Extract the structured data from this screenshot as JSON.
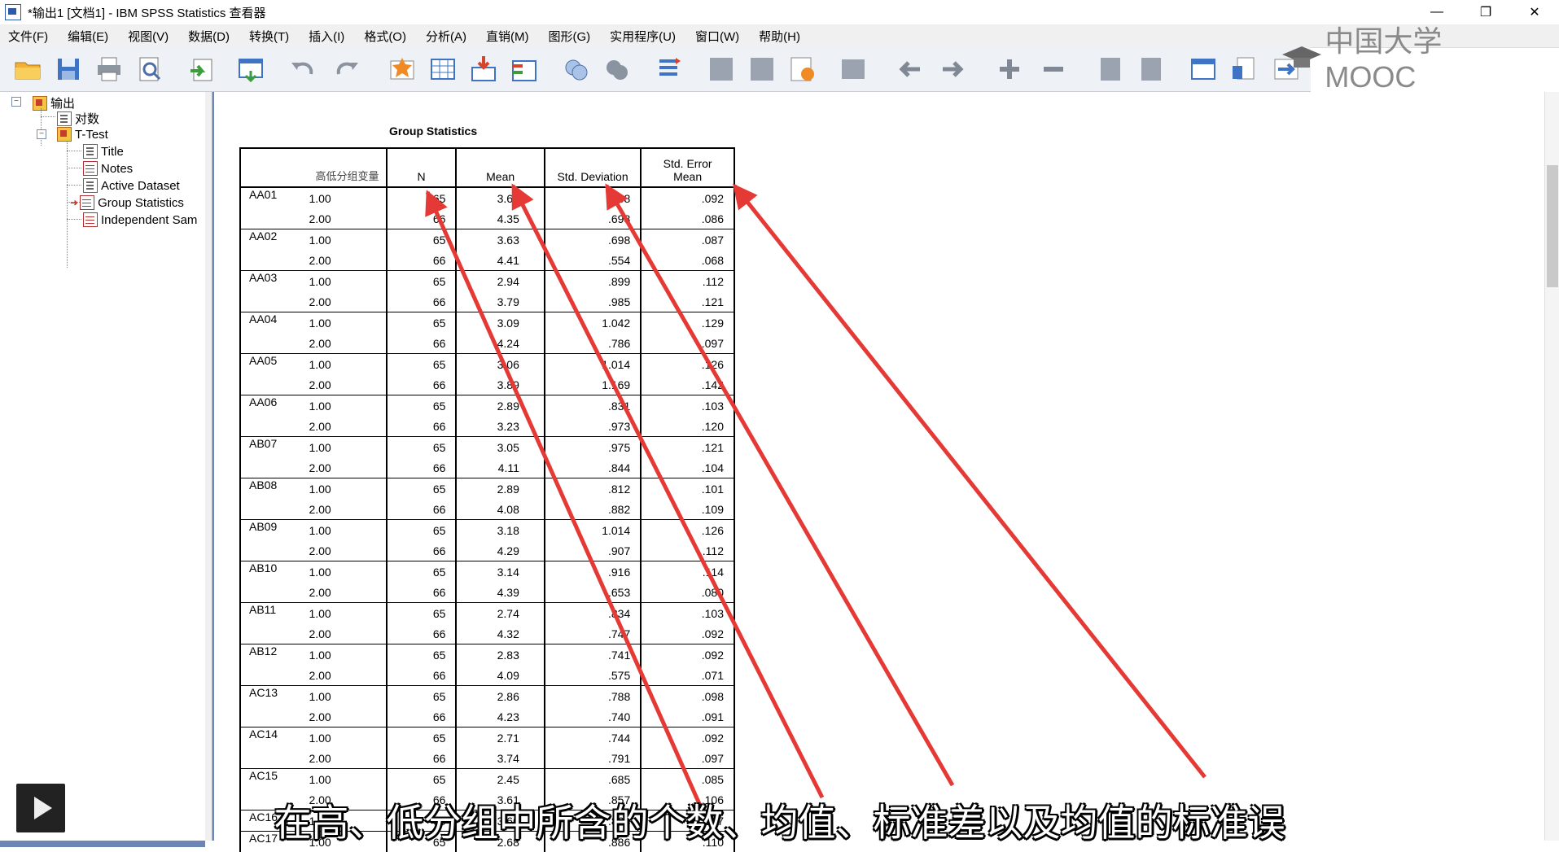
{
  "window": {
    "title": "*输出1 [文档1] - IBM SPSS Statistics 查看器",
    "minimize": "—",
    "restore": "❐",
    "close": "✕"
  },
  "menu": [
    "文件(F)",
    "编辑(E)",
    "视图(V)",
    "数据(D)",
    "转换(T)",
    "插入(I)",
    "格式(O)",
    "分析(A)",
    "直销(M)",
    "图形(G)",
    "实用程序(U)",
    "窗口(W)",
    "帮助(H)"
  ],
  "watermark": "中国大学MOOC",
  "outline": {
    "root": "输出",
    "log": "对数",
    "ttest": "T-Test",
    "children": [
      "Title",
      "Notes",
      "Active Dataset",
      "Group Statistics",
      "Independent Sam"
    ]
  },
  "table": {
    "title": "Group Statistics",
    "headers": {
      "group_var": "高低分组变量",
      "n": "N",
      "mean": "Mean",
      "sd": "Std. Deviation",
      "se_line1": "Std. Error",
      "se_line2": "Mean"
    },
    "rows": [
      {
        "var": "AA01",
        "groups": [
          [
            "1.00",
            "65",
            "3.65",
            ".738",
            ".092"
          ],
          [
            "2.00",
            "66",
            "4.35",
            ".698",
            ".086"
          ]
        ]
      },
      {
        "var": "AA02",
        "groups": [
          [
            "1.00",
            "65",
            "3.63",
            ".698",
            ".087"
          ],
          [
            "2.00",
            "66",
            "4.41",
            ".554",
            ".068"
          ]
        ]
      },
      {
        "var": "AA03",
        "groups": [
          [
            "1.00",
            "65",
            "2.94",
            ".899",
            ".112"
          ],
          [
            "2.00",
            "66",
            "3.79",
            ".985",
            ".121"
          ]
        ]
      },
      {
        "var": "AA04",
        "groups": [
          [
            "1.00",
            "65",
            "3.09",
            "1.042",
            ".129"
          ],
          [
            "2.00",
            "66",
            "4.24",
            ".786",
            ".097"
          ]
        ]
      },
      {
        "var": "AA05",
        "groups": [
          [
            "1.00",
            "65",
            "3.06",
            "1.014",
            ".126"
          ],
          [
            "2.00",
            "66",
            "3.89",
            "1.169",
            ".142"
          ]
        ]
      },
      {
        "var": "AA06",
        "groups": [
          [
            "1.00",
            "65",
            "2.89",
            ".831",
            ".103"
          ],
          [
            "2.00",
            "66",
            "3.23",
            ".973",
            ".120"
          ]
        ]
      },
      {
        "var": "AB07",
        "groups": [
          [
            "1.00",
            "65",
            "3.05",
            ".975",
            ".121"
          ],
          [
            "2.00",
            "66",
            "4.11",
            ".844",
            ".104"
          ]
        ]
      },
      {
        "var": "AB08",
        "groups": [
          [
            "1.00",
            "65",
            "2.89",
            ".812",
            ".101"
          ],
          [
            "2.00",
            "66",
            "4.08",
            ".882",
            ".109"
          ]
        ]
      },
      {
        "var": "AB09",
        "groups": [
          [
            "1.00",
            "65",
            "3.18",
            "1.014",
            ".126"
          ],
          [
            "2.00",
            "66",
            "4.29",
            ".907",
            ".112"
          ]
        ]
      },
      {
        "var": "AB10",
        "groups": [
          [
            "1.00",
            "65",
            "3.14",
            ".916",
            ".114"
          ],
          [
            "2.00",
            "66",
            "4.39",
            ".653",
            ".080"
          ]
        ]
      },
      {
        "var": "AB11",
        "groups": [
          [
            "1.00",
            "65",
            "2.74",
            ".834",
            ".103"
          ],
          [
            "2.00",
            "66",
            "4.32",
            ".747",
            ".092"
          ]
        ]
      },
      {
        "var": "AB12",
        "groups": [
          [
            "1.00",
            "65",
            "2.83",
            ".741",
            ".092"
          ],
          [
            "2.00",
            "66",
            "4.09",
            ".575",
            ".071"
          ]
        ]
      },
      {
        "var": "AC13",
        "groups": [
          [
            "1.00",
            "65",
            "2.86",
            ".788",
            ".098"
          ],
          [
            "2.00",
            "66",
            "4.23",
            ".740",
            ".091"
          ]
        ]
      },
      {
        "var": "AC14",
        "groups": [
          [
            "1.00",
            "65",
            "2.71",
            ".744",
            ".092"
          ],
          [
            "2.00",
            "66",
            "3.74",
            ".791",
            ".097"
          ]
        ]
      },
      {
        "var": "AC15",
        "groups": [
          [
            "1.00",
            "65",
            "2.45",
            ".685",
            ".085"
          ],
          [
            "2.00",
            "66",
            "3.61",
            ".857",
            ".106"
          ]
        ]
      },
      {
        "var": "AC16",
        "groups": [
          [
            "1.00",
            "65",
            "3.60",
            ".864",
            ".107"
          ]
        ]
      },
      {
        "var": "AC17",
        "groups": [
          [
            "1.00",
            "65",
            "2.68",
            ".886",
            ".110"
          ]
        ]
      }
    ]
  },
  "subtitle": "在高、低分组中所含的个数、均值、标准差以及均值的标准误",
  "colors": {
    "arrow": "#e53935",
    "toolbar_bg": "#eef1f5",
    "content_border": "#6b86b5"
  }
}
